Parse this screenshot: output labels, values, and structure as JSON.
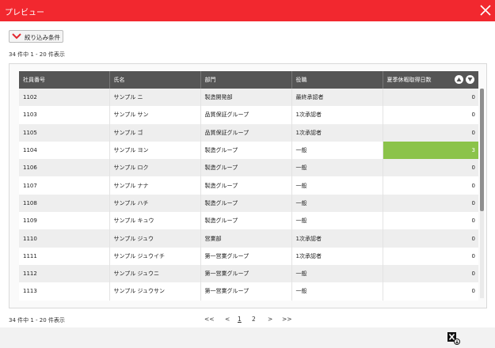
{
  "window": {
    "title": "プレビュー",
    "accent_color": "#f2282f"
  },
  "filter": {
    "label": "絞り込み条件"
  },
  "count_text": "34 件中 1 - 20 件表示",
  "table": {
    "columns": [
      "社員番号",
      "氏名",
      "部門",
      "役職",
      "夏季休暇取得日数"
    ],
    "rows": [
      [
        "1102",
        "サンプル ニ",
        "製造開発部",
        "最終承認者",
        "0"
      ],
      [
        "1103",
        "サンプル サン",
        "品質保証グループ",
        "1次承認者",
        "0"
      ],
      [
        "1105",
        "サンプル ゴ",
        "品質保証グループ",
        "1次承認者",
        "0"
      ],
      [
        "1104",
        "サンプル ヨン",
        "製造グループ",
        "一般",
        "3"
      ],
      [
        "1106",
        "サンプル ロク",
        "製造グループ",
        "一般",
        "0"
      ],
      [
        "1107",
        "サンプル ナナ",
        "製造グループ",
        "一般",
        "0"
      ],
      [
        "1108",
        "サンプル ハチ",
        "製造グループ",
        "一般",
        "0"
      ],
      [
        "1109",
        "サンプル キュウ",
        "製造グループ",
        "一般",
        "0"
      ],
      [
        "1110",
        "サンプル ジュウ",
        "営業部",
        "1次承認者",
        "0"
      ],
      [
        "1111",
        "サンプル ジュウイチ",
        "第一営業グループ",
        "1次承認者",
        "0"
      ],
      [
        "1112",
        "サンプル ジュウニ",
        "第一営業グループ",
        "一般",
        "0"
      ],
      [
        "1113",
        "サンプル ジュウサン",
        "第一営業グループ",
        "一般",
        "0"
      ]
    ],
    "highlight_color": "#8bc34a"
  },
  "pagination": {
    "first": "<<",
    "prev": "<",
    "pages": [
      "1",
      "2"
    ],
    "current_page": "1",
    "next": ">",
    "last": ">>"
  }
}
